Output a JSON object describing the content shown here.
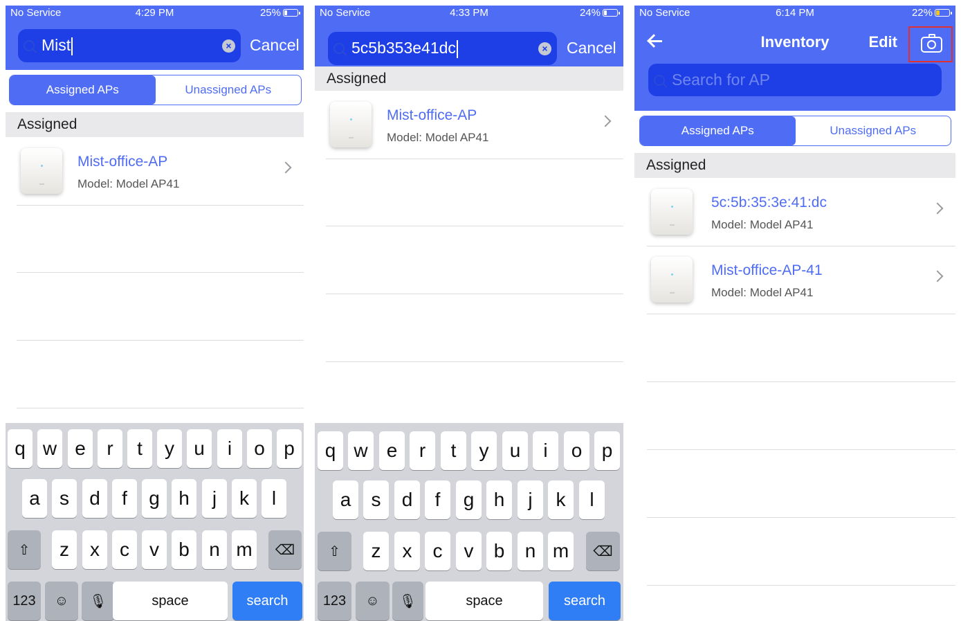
{
  "panel1": {
    "status": {
      "carrier": "No Service",
      "time": "4:29 PM",
      "battery": "25%",
      "battery_level": 0.25
    },
    "search": {
      "value": "Mist",
      "cancel": "Cancel"
    },
    "tabs": {
      "assigned": "Assigned APs",
      "unassigned": "Unassigned APs"
    },
    "section": "Assigned",
    "rows": [
      {
        "name": "Mist-office-AP",
        "model": "Model: Model AP41"
      }
    ],
    "keyboard": {
      "row1": [
        "q",
        "w",
        "e",
        "r",
        "t",
        "y",
        "u",
        "i",
        "o",
        "p"
      ],
      "row2": [
        "a",
        "s",
        "d",
        "f",
        "g",
        "h",
        "j",
        "k",
        "l"
      ],
      "row3": [
        "z",
        "x",
        "c",
        "v",
        "b",
        "n",
        "m"
      ],
      "numbers": "123",
      "space": "space",
      "action": "search"
    }
  },
  "panel2": {
    "status": {
      "carrier": "No Service",
      "time": "4:33 PM",
      "battery": "24%",
      "battery_level": 0.24
    },
    "search": {
      "value": "5c5b353e41dc",
      "cancel": "Cancel"
    },
    "section": "Assigned",
    "rows": [
      {
        "name": "Mist-office-AP",
        "model": "Model: Model AP41"
      }
    ],
    "keyboard": {
      "row1": [
        "q",
        "w",
        "e",
        "r",
        "t",
        "y",
        "u",
        "i",
        "o",
        "p"
      ],
      "row2": [
        "a",
        "s",
        "d",
        "f",
        "g",
        "h",
        "j",
        "k",
        "l"
      ],
      "row3": [
        "z",
        "x",
        "c",
        "v",
        "b",
        "n",
        "m"
      ],
      "numbers": "123",
      "space": "space",
      "action": "search"
    }
  },
  "panel3": {
    "status": {
      "carrier": "No Service",
      "time": "6:14 PM",
      "battery": "22%",
      "battery_level": 0.22
    },
    "nav": {
      "title": "Inventory",
      "edit": "Edit"
    },
    "search": {
      "placeholder": "Search for AP"
    },
    "tabs": {
      "assigned": "Assigned APs",
      "unassigned": "Unassigned APs"
    },
    "section": "Assigned",
    "rows": [
      {
        "name": "5c:5b:35:3e:41:dc",
        "model": "Model: Model AP41"
      },
      {
        "name": "Mist-office-AP-41",
        "model": "Model: Model AP41"
      }
    ]
  },
  "colors": {
    "accent": "#4f6cf5",
    "search_bg": "#1f3fe6",
    "highlight": "#e03030",
    "key_action": "#2f7ef6"
  }
}
